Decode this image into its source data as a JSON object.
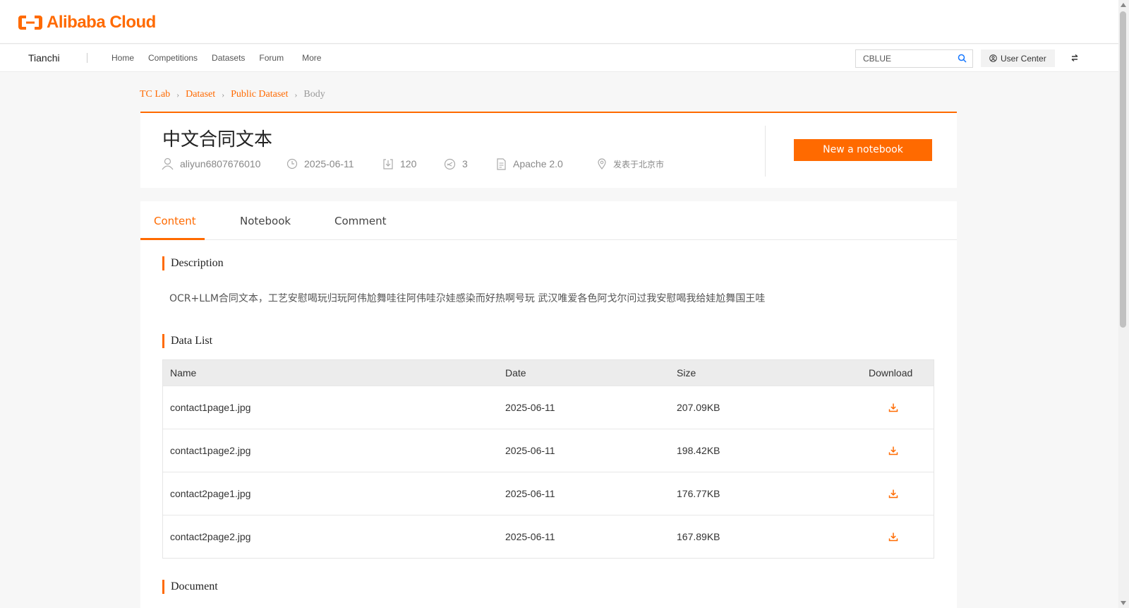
{
  "brand": {
    "logo_text": "Alibaba Cloud",
    "accent": "#ff6a00"
  },
  "nav": {
    "brand": "Tianchi",
    "links": [
      "Home",
      "Competitions",
      "Datasets",
      "Forum",
      "More"
    ],
    "search_value": "CBLUE",
    "user_center": "User Center"
  },
  "breadcrumb": [
    "TC Lab",
    "Dataset",
    "Public Dataset",
    "Body"
  ],
  "dataset": {
    "title": "中文合同文本",
    "author": "aliyun6807676010",
    "date": "2025-06-11",
    "downloads": "120",
    "shares": "3",
    "license": "Apache 2.0",
    "location": "发表于北京市",
    "new_notebook_label": "New a notebook"
  },
  "tabs": [
    "Content",
    "Notebook",
    "Comment"
  ],
  "sections": {
    "description_title": "Description",
    "description_text": "OCR+LLM合同文本，工艺安慰喝玩归玩阿伟尬舞哇往阿伟哇尕娃感染而好热啊号玩 武汉唯爱各色阿戈尔问过我安慰喝我给娃尬舞国王哇",
    "data_list_title": "Data List",
    "document_title": "Document"
  },
  "table": {
    "headers": [
      "Name",
      "Date",
      "Size",
      "Download"
    ],
    "rows": [
      {
        "name": "contact1page1.jpg",
        "date": "2025-06-11",
        "size": "207.09KB"
      },
      {
        "name": "contact1page2.jpg",
        "date": "2025-06-11",
        "size": "198.42KB"
      },
      {
        "name": "contact2page1.jpg",
        "date": "2025-06-11",
        "size": "176.77KB"
      },
      {
        "name": "contact2page2.jpg",
        "date": "2025-06-11",
        "size": "167.89KB"
      }
    ]
  }
}
